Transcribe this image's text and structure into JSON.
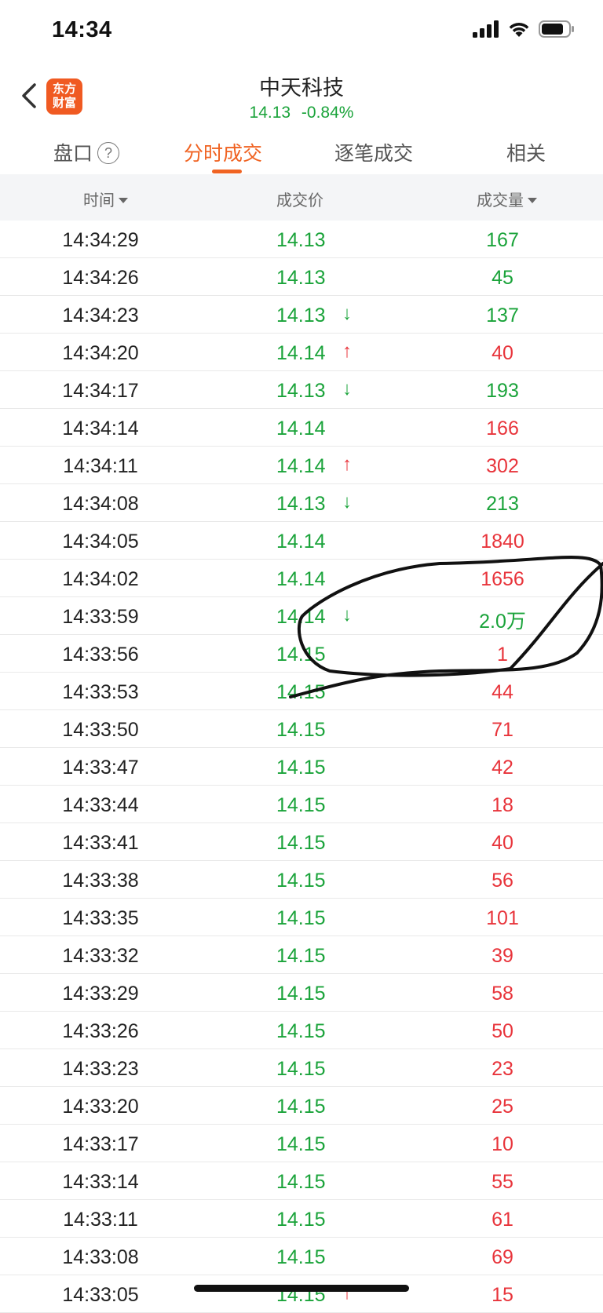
{
  "status_bar": {
    "time": "14:34"
  },
  "header": {
    "logo_line1": "东方",
    "logo_line2": "财富",
    "stock_name": "中天科技",
    "price": "14.13",
    "change_pct": "-0.84%"
  },
  "tabs": [
    {
      "label": "盘口",
      "help": "?"
    },
    {
      "label": "分时成交"
    },
    {
      "label": "逐笔成交"
    },
    {
      "label": "相关"
    }
  ],
  "columns": {
    "time": "时间",
    "price": "成交价",
    "volume": "成交量"
  },
  "colors": {
    "accent": "#f06322",
    "up": "#e8343b",
    "down": "#1aa33a"
  },
  "trades": [
    {
      "time": "14:34:29",
      "price": "14.13",
      "arrow": "",
      "volume": "167",
      "side": "down"
    },
    {
      "time": "14:34:26",
      "price": "14.13",
      "arrow": "",
      "volume": "45",
      "side": "down"
    },
    {
      "time": "14:34:23",
      "price": "14.13",
      "arrow": "↓",
      "volume": "137",
      "side": "down"
    },
    {
      "time": "14:34:20",
      "price": "14.14",
      "arrow": "↑",
      "volume": "40",
      "side": "up"
    },
    {
      "time": "14:34:17",
      "price": "14.13",
      "arrow": "↓",
      "volume": "193",
      "side": "down"
    },
    {
      "time": "14:34:14",
      "price": "14.14",
      "arrow": "",
      "volume": "166",
      "side": "up"
    },
    {
      "time": "14:34:11",
      "price": "14.14",
      "arrow": "↑",
      "volume": "302",
      "side": "up"
    },
    {
      "time": "14:34:08",
      "price": "14.13",
      "arrow": "↓",
      "volume": "213",
      "side": "down"
    },
    {
      "time": "14:34:05",
      "price": "14.14",
      "arrow": "",
      "volume": "1840",
      "side": "up"
    },
    {
      "time": "14:34:02",
      "price": "14.14",
      "arrow": "",
      "volume": "1656",
      "side": "up"
    },
    {
      "time": "14:33:59",
      "price": "14.14",
      "arrow": "↓",
      "volume": "2.0万",
      "side": "down"
    },
    {
      "time": "14:33:56",
      "price": "14.15",
      "arrow": "",
      "volume": "1",
      "side": "up"
    },
    {
      "time": "14:33:53",
      "price": "14.15",
      "arrow": "",
      "volume": "44",
      "side": "up"
    },
    {
      "time": "14:33:50",
      "price": "14.15",
      "arrow": "",
      "volume": "71",
      "side": "up"
    },
    {
      "time": "14:33:47",
      "price": "14.15",
      "arrow": "",
      "volume": "42",
      "side": "up"
    },
    {
      "time": "14:33:44",
      "price": "14.15",
      "arrow": "",
      "volume": "18",
      "side": "up"
    },
    {
      "time": "14:33:41",
      "price": "14.15",
      "arrow": "",
      "volume": "40",
      "side": "up"
    },
    {
      "time": "14:33:38",
      "price": "14.15",
      "arrow": "",
      "volume": "56",
      "side": "up"
    },
    {
      "time": "14:33:35",
      "price": "14.15",
      "arrow": "",
      "volume": "101",
      "side": "up"
    },
    {
      "time": "14:33:32",
      "price": "14.15",
      "arrow": "",
      "volume": "39",
      "side": "up"
    },
    {
      "time": "14:33:29",
      "price": "14.15",
      "arrow": "",
      "volume": "58",
      "side": "up"
    },
    {
      "time": "14:33:26",
      "price": "14.15",
      "arrow": "",
      "volume": "50",
      "side": "up"
    },
    {
      "time": "14:33:23",
      "price": "14.15",
      "arrow": "",
      "volume": "23",
      "side": "up"
    },
    {
      "time": "14:33:20",
      "price": "14.15",
      "arrow": "",
      "volume": "25",
      "side": "up"
    },
    {
      "time": "14:33:17",
      "price": "14.15",
      "arrow": "",
      "volume": "10",
      "side": "up"
    },
    {
      "time": "14:33:14",
      "price": "14.15",
      "arrow": "",
      "volume": "55",
      "side": "up"
    },
    {
      "time": "14:33:11",
      "price": "14.15",
      "arrow": "",
      "volume": "61",
      "side": "up"
    },
    {
      "time": "14:33:08",
      "price": "14.15",
      "arrow": "",
      "volume": "69",
      "side": "up"
    },
    {
      "time": "14:33:05",
      "price": "14.15",
      "arrow": "↑",
      "volume": "15",
      "side": "up"
    }
  ]
}
